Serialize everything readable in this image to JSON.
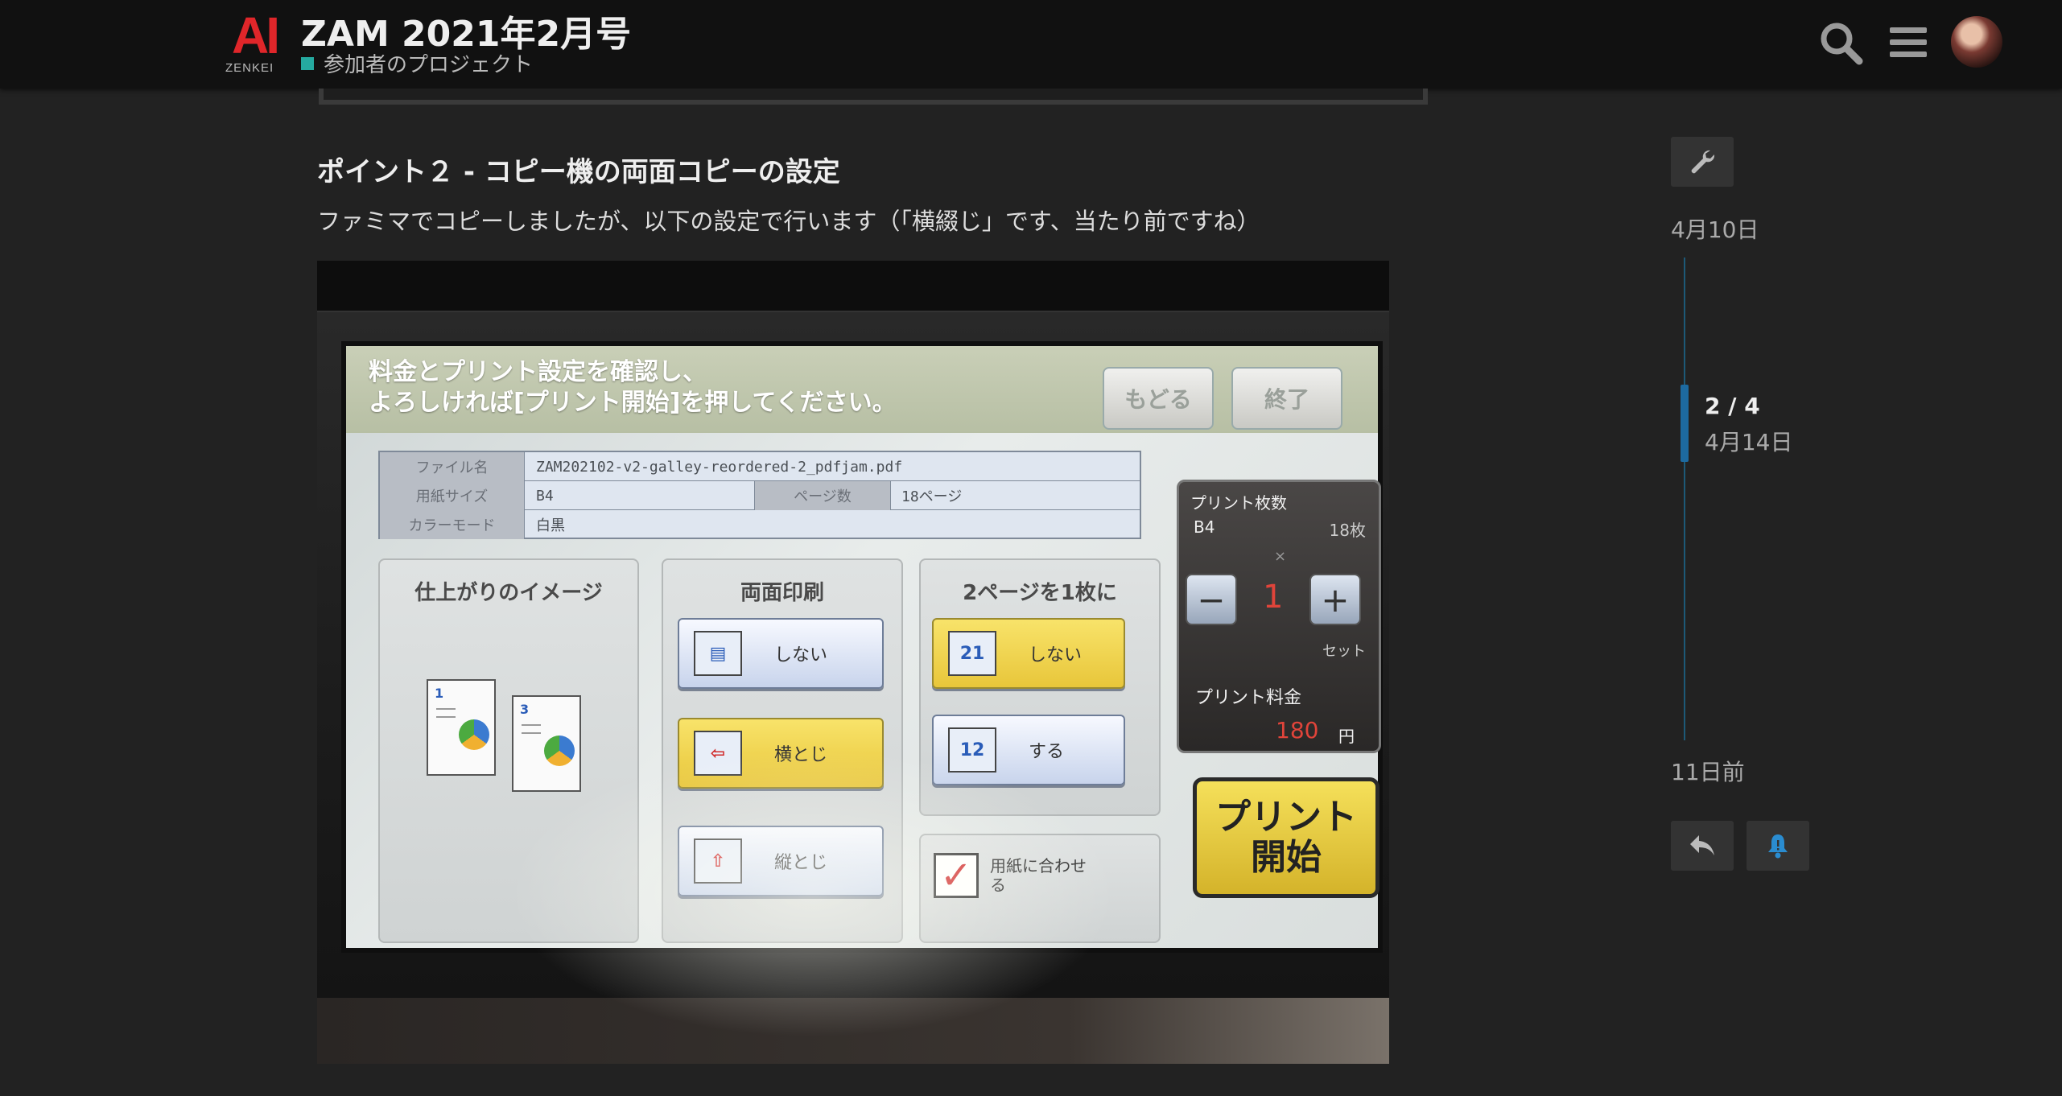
{
  "header": {
    "logo_text": "AI",
    "logo_sub": "ZENKEI",
    "title": "ZAM 2021年2月号",
    "category": "参加者のプロジェクト",
    "category_color": "#25aaa0",
    "icons": [
      "search-icon",
      "hamburger-menu-icon",
      "user-avatar"
    ]
  },
  "post": {
    "heading": "ポイント２ - コピー機の両面コピーの設定",
    "paragraph": "ファミマでコピーしましたが、以下の設定で行います（「横綴じ」です、当たり前ですね）",
    "photo": {
      "message_line1": "料金とプリント設定を確認し、",
      "message_line2": "よろしければ[プリント開始]を押してください。",
      "back_button": "もどる",
      "end_button": "終了",
      "file_label": "ファイル名",
      "file_value": "ZAM202102-v2-galley-reordered-2_pdfjam.pdf",
      "paper_label": "用紙サイズ",
      "paper_value": "B4",
      "pages_label": "ページ数",
      "pages_value": "18ページ",
      "color_label": "カラーモード",
      "color_value": "白黒",
      "image_panel_title": "仕上がりのイメージ",
      "duplex_title": "両面印刷",
      "duplex_none": "しない",
      "duplex_long": "横とじ",
      "duplex_short": "縦とじ",
      "nup_title": "2ページを1枚に",
      "nup_none": "しない",
      "nup_yes": "する",
      "fit_label": "用紙に合わせる",
      "count_title": "プリント枚数",
      "count_size": "B4",
      "count_sheets": "18枚",
      "count_x": "×",
      "count_qty": "1",
      "count_set": "セット",
      "fee_label": "プリント料金",
      "fee_value": "180",
      "fee_unit": "円",
      "start_line1": "プリント",
      "start_line2": "開始"
    }
  },
  "timeline": {
    "start_date": "4月10日",
    "position": "2 / 4",
    "position_date": "4月14日",
    "end_date": "11日前",
    "accent_color": "#1d6aa0"
  }
}
